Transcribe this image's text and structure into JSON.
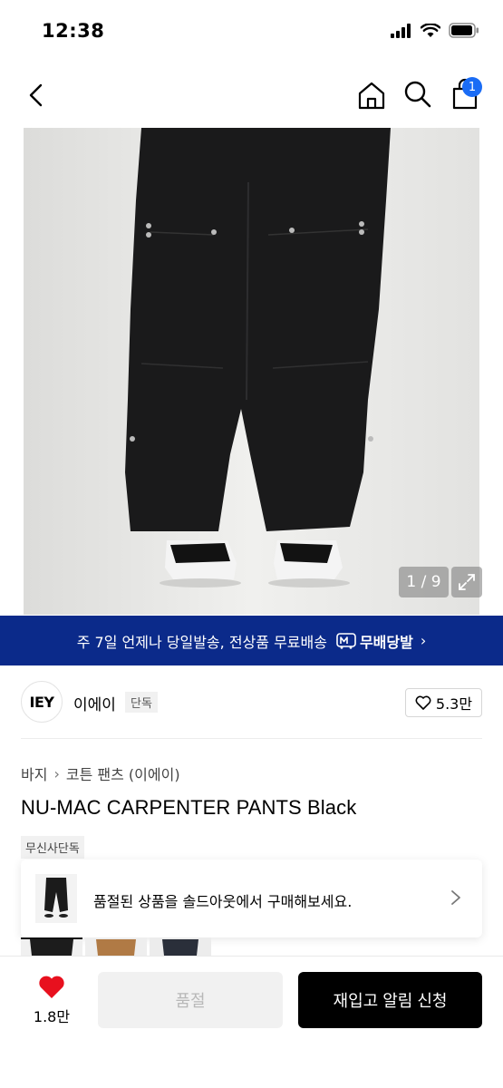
{
  "status_bar": {
    "time": "12:38"
  },
  "header": {
    "cart_count": "1"
  },
  "gallery": {
    "counter": "1 / 9"
  },
  "shipping_banner": {
    "text": "주 7일 언제나 당일발송, 전상품 무료배송",
    "badge": "무배당발",
    "chevron": "›"
  },
  "brand": {
    "logo_text": "IEY",
    "name": "이에이",
    "tag": "단독",
    "like_count": "5.3만"
  },
  "breadcrumb": {
    "items": [
      "바지",
      "코튼 팬츠 (이에이)"
    ],
    "separator": "›"
  },
  "product": {
    "title": "NU-MAC CARPENTER PANTS Black",
    "exclusive_tag": "무신사단독"
  },
  "soldout_card": {
    "text": "품절된 상품을 솔드아웃에서 구매해보세요."
  },
  "bottom_bar": {
    "heart_count": "1.8만",
    "soldout_label": "품절",
    "restock_label": "재입고 알림 신청"
  },
  "colors": {
    "brand_blue": "#0b2a8a",
    "badge_blue": "#1a6cf5",
    "heart_red": "#e8101e",
    "primary_button": "#000000"
  }
}
